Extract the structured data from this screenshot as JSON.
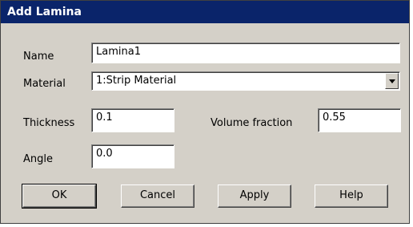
{
  "window": {
    "title": "Add Lamina"
  },
  "form": {
    "name_label": "Name",
    "name_value": "Lamina1",
    "material_label": "Material",
    "material_value": "1:Strip Material",
    "thickness_label": "Thickness",
    "thickness_value": "0.1",
    "volume_fraction_label": "Volume fraction",
    "volume_fraction_value": "0.55",
    "angle_label": "Angle",
    "angle_value": "0.0"
  },
  "buttons": {
    "ok": "OK",
    "cancel": "Cancel",
    "apply": "Apply",
    "help": "Help"
  },
  "icons": {
    "dropdown": "chevron-down-icon"
  }
}
